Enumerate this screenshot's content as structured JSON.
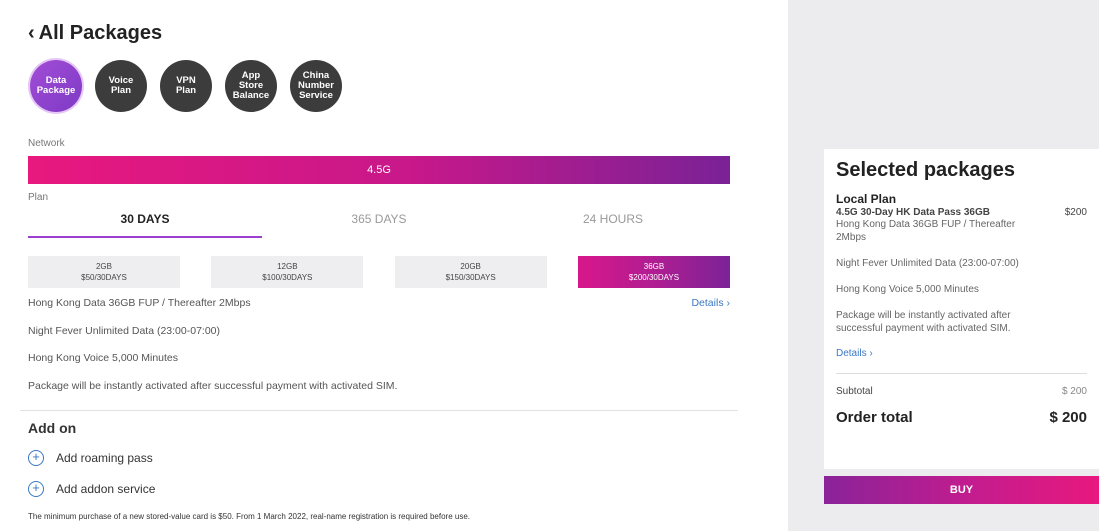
{
  "header": {
    "back_label": "All Packages"
  },
  "categories": [
    {
      "label_lines": [
        "Data",
        "Package"
      ],
      "active": true
    },
    {
      "label_lines": [
        "Voice",
        "Plan"
      ],
      "active": false
    },
    {
      "label_lines": [
        "VPN",
        "Plan"
      ],
      "active": false
    },
    {
      "label_lines": [
        "App",
        "Store",
        "Balance"
      ],
      "active": false
    },
    {
      "label_lines": [
        "China",
        "Number",
        "Service"
      ],
      "active": false
    }
  ],
  "network": {
    "label": "Network",
    "selected": "4.5G"
  },
  "plan": {
    "label": "Plan",
    "tabs": [
      "30 DAYS",
      "365 DAYS",
      "24 HOURS"
    ],
    "active_tab": "30 DAYS",
    "options": [
      {
        "size": "2GB",
        "price": "$50/30DAYS"
      },
      {
        "size": "12GB",
        "price": "$100/30DAYS"
      },
      {
        "size": "20GB",
        "price": "$150/30DAYS"
      },
      {
        "size": "36GB",
        "price": "$200/30DAYS"
      }
    ],
    "active_option": "36GB"
  },
  "description": {
    "line1": "Hong Kong Data 36GB FUP / Thereafter 2Mbps",
    "line2": "Night Fever Unlimited Data (23:00-07:00)",
    "line3": "Hong Kong Voice 5,000 Minutes",
    "line4": "Package will be instantly activated after successful payment with activated SIM.",
    "details_label": "Details"
  },
  "addon": {
    "title": "Add on",
    "roaming": "Add roaming pass",
    "service": "Add addon service"
  },
  "footnote": "The minimum purchase of a new stored-value card is $50. From 1 March 2022, real-name registration is required before use.",
  "cart": {
    "title": "Selected packages",
    "plan_group": "Local Plan",
    "package_name": "4.5G 30-Day HK Data Pass 36GB",
    "package_price": "$200",
    "package_sub": "Hong Kong Data 36GB FUP / Thereafter 2Mbps",
    "line2": "Night Fever Unlimited Data (23:00-07:00)",
    "line3": "Hong Kong Voice 5,000 Minutes",
    "line4": "Package will be instantly activated after successful payment with activated SIM.",
    "details_label": "Details",
    "subtotal_label": "Subtotal",
    "subtotal_value": "$ 200",
    "total_label": "Order total",
    "total_value": "$ 200",
    "buy_label": "BUY"
  },
  "colors": {
    "accent_gradient_start": "#e8187e",
    "accent_gradient_end": "#7a2296",
    "link": "#3a78c3",
    "active_category": "#8f44cf"
  }
}
